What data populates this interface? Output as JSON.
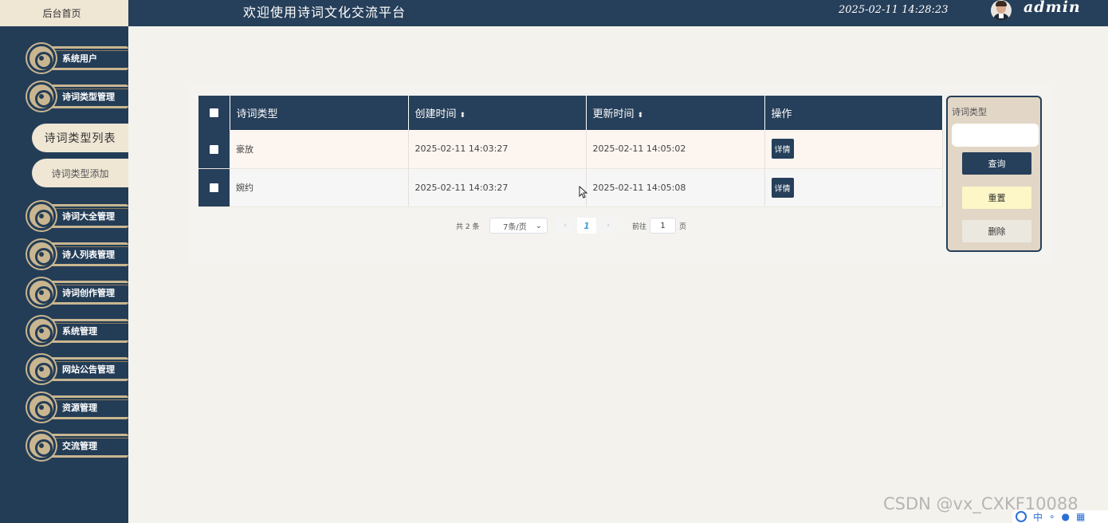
{
  "header": {
    "home_tab": "后台首页",
    "site_title": "欢迎使用诗词文化交流平台",
    "clock": "2025-02-11 14:28:23",
    "username": "admin"
  },
  "sidebar": {
    "items": [
      {
        "label": "系统用户"
      },
      {
        "label": "诗词类型管理"
      },
      {
        "label": "诗词大全管理"
      },
      {
        "label": "诗人列表管理"
      },
      {
        "label": "诗词创作管理"
      },
      {
        "label": "系统管理"
      },
      {
        "label": "网站公告管理"
      },
      {
        "label": "资源管理"
      },
      {
        "label": "交流管理"
      }
    ],
    "subitems": [
      {
        "label": "诗词类型列表",
        "active": true
      },
      {
        "label": "诗词类型添加",
        "active": false
      }
    ]
  },
  "table": {
    "columns": [
      "诗词类型",
      "创建时间",
      "更新时间",
      "操作"
    ],
    "sort_icon": "⬍",
    "rows": [
      {
        "type": "豪放",
        "created": "2025-02-11 14:03:27",
        "updated": "2025-02-11 14:05:02",
        "action": "详情"
      },
      {
        "type": "婉约",
        "created": "2025-02-11 14:03:27",
        "updated": "2025-02-11 14:05:08",
        "action": "详情"
      }
    ]
  },
  "pagination": {
    "total": "共 2 条",
    "page_size": "7条/页",
    "current_page": "1",
    "goto_label": "前往",
    "goto_value": "1",
    "page_unit": "页"
  },
  "search": {
    "label": "诗词类型",
    "value": "",
    "query_button": "查询",
    "reset_button": "重置",
    "delete_button": "删除"
  },
  "watermark": "CSDN @vx_CXKF10088",
  "ime": {
    "lang": "中"
  },
  "colors": {
    "primary": "#263f5a",
    "cream": "#efe6d4",
    "accent_gold": "#c9b690"
  }
}
